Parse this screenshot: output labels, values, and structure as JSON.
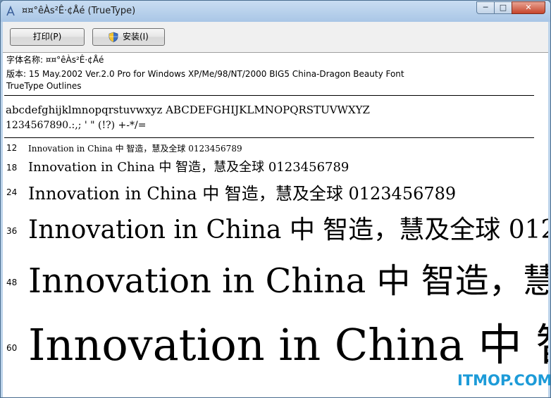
{
  "window": {
    "title": "¤¤°êÀs²Ê·¢Åé (TrueType)",
    "min_label": "─",
    "max_label": "□",
    "close_label": "✕"
  },
  "toolbar": {
    "print_label": "打印(P)",
    "install_label": "安装(I)"
  },
  "info": {
    "name_line": "字体名称: ¤¤°êÀs²Ê·¢Åé",
    "version_line": "版本: 15 May.2002 Ver.2.0 Pro for Windows XP/Me/98/NT/2000 BIG5 China-Dragon Beauty Font",
    "outline_line": "TrueType Outlines"
  },
  "charset": {
    "letters": "abcdefghijklmnopqrstuvwxyz  ABCDEFGHIJKLMNOPQRSTUVWXYZ",
    "digits": "1234567890.:,;  '  \"  (!?)  +-*/="
  },
  "samples": {
    "text": "Innovation  in  China  中  智造，慧及全球  0123456789",
    "rows": [
      {
        "size": "12"
      },
      {
        "size": "18"
      },
      {
        "size": "24"
      },
      {
        "size": "36"
      },
      {
        "size": "48"
      },
      {
        "size": "60"
      }
    ]
  },
  "watermark": "ITMOP.COM",
  "colors": {
    "title_bar": "#bcd3ea",
    "close_button": "#c7452c",
    "watermark": "#1d9bd8"
  }
}
